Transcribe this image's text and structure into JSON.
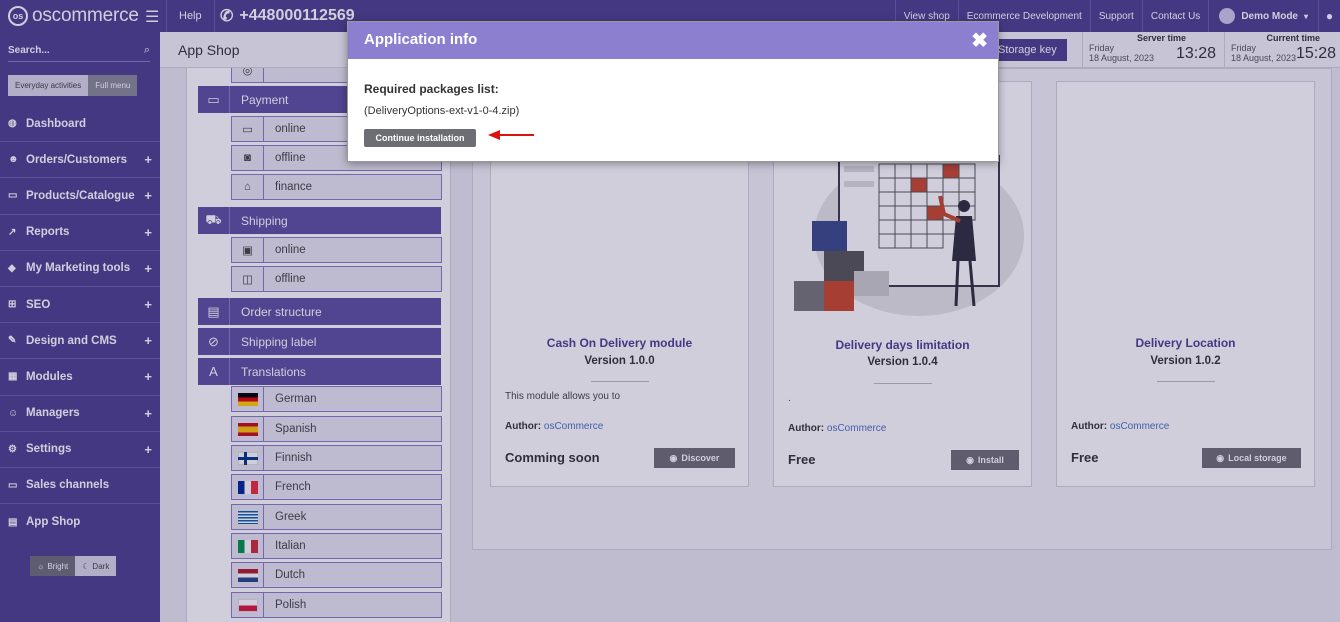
{
  "topbar": {
    "logo_text": "oscommerce",
    "help": "Help",
    "phone": "+448000112569",
    "links": [
      "View shop",
      "Ecommerce Development",
      "Support",
      "Contact Us"
    ],
    "user": "Demo Mode"
  },
  "sidebar": {
    "search_placeholder": "Search...",
    "toggle": [
      "Everyday activities",
      "Full menu"
    ],
    "items": [
      {
        "label": "Dashboard",
        "plus": false
      },
      {
        "label": "Orders/Customers",
        "plus": true
      },
      {
        "label": "Products/Catalogue",
        "plus": true
      },
      {
        "label": "Reports",
        "plus": true
      },
      {
        "label": "My Marketing tools",
        "plus": true
      },
      {
        "label": "SEO",
        "plus": true
      },
      {
        "label": "Design and CMS",
        "plus": true
      },
      {
        "label": "Modules",
        "plus": true
      },
      {
        "label": "Managers",
        "plus": true
      },
      {
        "label": "Settings",
        "plus": true
      },
      {
        "label": "Sales channels",
        "plus": false
      },
      {
        "label": "App Shop",
        "plus": false
      }
    ],
    "theme": [
      "Bright",
      "Dark"
    ]
  },
  "header": {
    "title": "App Shop",
    "storage_key": "Storage key",
    "server_time_label": "Server time",
    "current_time_label": "Current time",
    "day": "Friday",
    "date": "18 August, 2023",
    "server_time": "13:28",
    "current_time": "15:28"
  },
  "categories": {
    "payment": "Payment",
    "payment_subs": [
      "online",
      "offline",
      "finance"
    ],
    "shipping": "Shipping",
    "shipping_subs": [
      "online",
      "offline"
    ],
    "order_structure": "Order structure",
    "shipping_label": "Shipping label",
    "translations": "Translations",
    "languages": [
      "German",
      "Spanish",
      "Finnish",
      "French",
      "Greek",
      "Italian",
      "Dutch",
      "Polish"
    ]
  },
  "cards": [
    {
      "title": "Cash On Delivery module",
      "version": "Version 1.0.0",
      "desc": "This module allows you to",
      "author_label": "Author:",
      "author": "osCommerce",
      "price": "Comming soon",
      "button": "Discover"
    },
    {
      "title": "Delivery days limitation",
      "version": "Version 1.0.4",
      "desc": ".",
      "author_label": "Author:",
      "author": "osCommerce",
      "price": "Free",
      "button": "Install"
    },
    {
      "title": "Delivery Location",
      "version": "Version 1.0.2",
      "desc": "",
      "author_label": "Author:",
      "author": "osCommerce",
      "price": "Free",
      "button": "Local storage"
    }
  ],
  "modal": {
    "title": "Application info",
    "label": "Required packages list:",
    "package": "(DeliveryOptions-ext-v1-0-4.zip)",
    "button": "Continue installation"
  },
  "colors": {
    "brand": "#4e3f8f",
    "modal_header": "#8c7fd0",
    "button_gray": "#6d6e73",
    "arrow_red": "#d9140f"
  }
}
